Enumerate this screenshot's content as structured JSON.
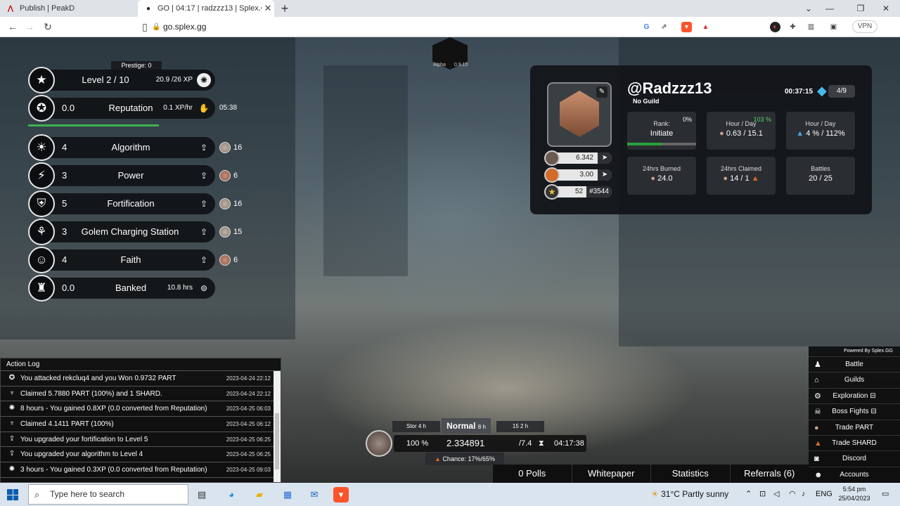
{
  "browser": {
    "tabs": [
      {
        "title": "Publish | PeakD",
        "active": false
      },
      {
        "title": "GO | 04:17 | radzzz13 | Splex.GG",
        "active": true
      }
    ],
    "url": "go.splex.gg",
    "vpn_label": "VPN"
  },
  "stats": {
    "prestige": "Prestige: 0",
    "level": {
      "name": "Level 2 / 10",
      "xp": "20.9 /26 XP"
    },
    "reputation": {
      "value": "0.0",
      "name": "Reputation",
      "rate": "0.1 XP/hr",
      "time": "05:38"
    },
    "rows": [
      {
        "value": "4",
        "name": "Algorithm",
        "cost": "16"
      },
      {
        "value": "3",
        "name": "Power",
        "cost": "6"
      },
      {
        "value": "5",
        "name": "Fortification",
        "cost": "16"
      },
      {
        "value": "3",
        "name": "Golem Charging Station",
        "cost": "15"
      },
      {
        "value": "4",
        "name": "Faith",
        "cost": "6"
      }
    ],
    "banked": {
      "value": "0.0",
      "name": "Banked",
      "hrs": "10.8 hrs"
    }
  },
  "top_avatar": {
    "left": "Alpha",
    "right": "0.9.10"
  },
  "profile": {
    "username": "@Radzzz13",
    "guild": "No Guild",
    "timer": "00:37:15",
    "energy": "4/9",
    "part_balance": "6.342",
    "shard_balance": "3.00",
    "level_num": "52",
    "rank_num": "#3544",
    "tiles": [
      {
        "label": "Rank:",
        "value": "Initiate",
        "corner": "0%"
      },
      {
        "label": "Hour / Day",
        "value": "0.63 / 15.1",
        "corner": "103 %"
      },
      {
        "label": "Hour / Day",
        "value": "4 % / 112%",
        "corner": ""
      },
      {
        "label": "24hrs Burned",
        "value": "24.0",
        "corner": ""
      },
      {
        "label": "24hrs Claimed",
        "value": "14 / 1",
        "corner": ""
      },
      {
        "label": "Battles",
        "value": "20 / 25",
        "corner": ""
      }
    ]
  },
  "action_log": {
    "title": "Action Log",
    "entries": [
      {
        "text": "You attacked rekcluq4 and you Won 0.9732 PART",
        "date": "2023-04-24 22:12",
        "icon": "attack-icon"
      },
      {
        "text": "Claimed 5.7880 PART (100%) and 1 SHARD.",
        "date": "2023-04-24 22:12",
        "icon": "claim-icon"
      },
      {
        "text": "8 hours - You gained 0.8XP (0.0 converted from Reputation)",
        "date": "2023-04-25 06:03",
        "icon": "xp-icon"
      },
      {
        "text": "Claimed 4.1411 PART (100%)",
        "date": "2023-04-25 06:12",
        "icon": "claim-icon"
      },
      {
        "text": "You upgraded your fortification to Level 5",
        "date": "2023-04-25 06:25",
        "icon": "upgrade-icon"
      },
      {
        "text": "You upgraded your algorithm to Level 4",
        "date": "2023-04-25 06:25",
        "icon": "upgrade-icon"
      },
      {
        "text": "3 hours - You gained 0.3XP (0.0 converted from Reputation)",
        "date": "2023-04-25 09:03",
        "icon": "xp-icon"
      }
    ]
  },
  "right_menu": {
    "powered_by": "Powered By Splex.GG",
    "items": [
      "Battle",
      "Guilds",
      "Exploration",
      "Boss Fights",
      "Trade PART",
      "Trade SHARD",
      "Discord",
      "Accounts"
    ]
  },
  "mining": {
    "mode": "Normal",
    "mode_hours": "8 h",
    "left_side": "Stor 4 h",
    "right_side": "15 2 h",
    "percent": "100 %",
    "amount": "2.334891",
    "rate": "/7.4",
    "time": "04:17:38",
    "chance": "Chance: 17%/65%"
  },
  "bottom_nav": [
    "0 Polls",
    "Whitepaper",
    "Statistics",
    "Referrals (6)"
  ],
  "taskbar": {
    "search_placeholder": "Type here to search",
    "weather": "31°C  Partly sunny",
    "lang": "ENG",
    "time": "5:54 pm",
    "date": "25/04/2023"
  }
}
